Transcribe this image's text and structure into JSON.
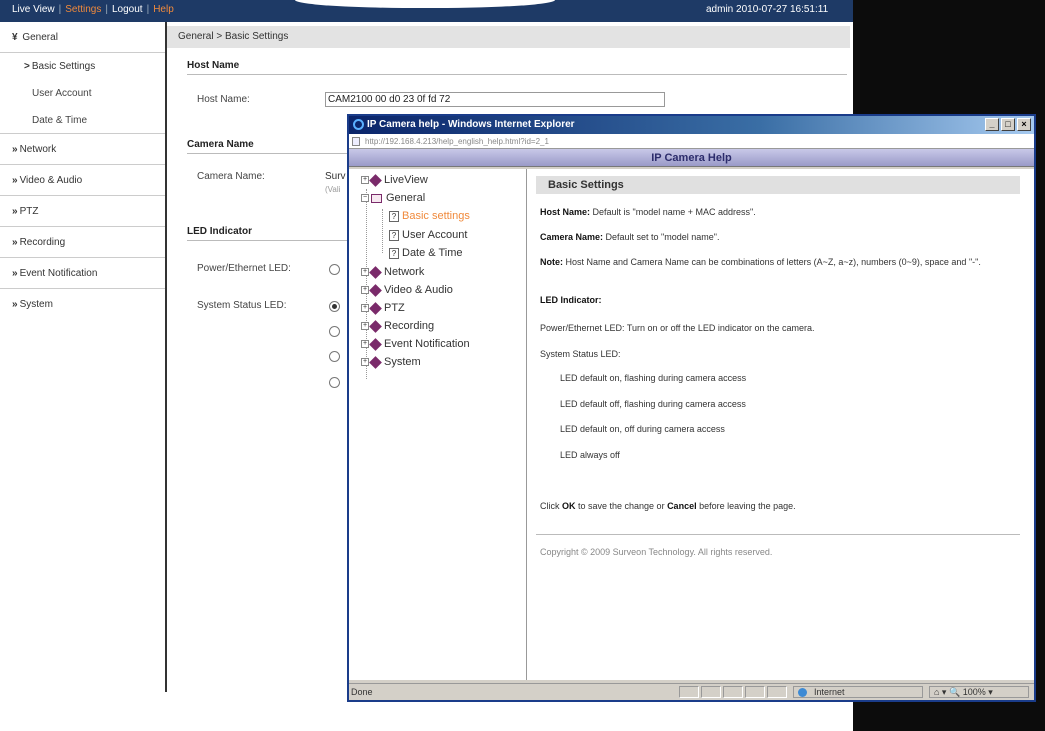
{
  "topbar": {
    "nav": [
      "Live View",
      "Settings",
      "Logout",
      "Help"
    ],
    "user": "admin",
    "datetime": "2010-07-27  16:51:11"
  },
  "sidebar": {
    "general": "General",
    "sub": [
      "Basic Settings",
      "User Account",
      "Date & Time"
    ],
    "items": [
      "Network",
      "Video & Audio",
      "PTZ",
      "Recording",
      "Event Notification",
      "System"
    ]
  },
  "main": {
    "breadcrumb": "General > Basic Settings",
    "host_section": "Host Name",
    "host_label": "Host Name:",
    "host_value": "CAM2100 00 d0 23 0f fd 72",
    "camera_section": "Camera Name",
    "camera_label": "Camera Name:",
    "camera_value": "Surv",
    "camera_hint": "(Vali",
    "led_section": "LED Indicator",
    "power_led_label": "Power/Ethernet LED:",
    "status_led_label": "System Status LED:"
  },
  "ie": {
    "title": "IP Camera help - Windows Internet Explorer",
    "address": "http://192.168.4.213/help_english_help.html?id=2_1",
    "banner": "IP Camera Help",
    "tree": {
      "liveview": "LiveView",
      "general": "General",
      "basic": "Basic settings",
      "user": "User Account",
      "date": "Date & Time",
      "network": "Network",
      "video": "Video & Audio",
      "ptz": "PTZ",
      "recording": "Recording",
      "event": "Event Notification",
      "system": "System"
    },
    "content": {
      "title": "Basic Settings",
      "host_bold": "Host Name:",
      "host_text": " Default is \"model name + MAC address\".",
      "camera_bold": "Camera Name:",
      "camera_text": " Default set to \"model name\".",
      "note_bold": "Note:",
      "note_text": " Host Name and Camera Name can be combinations of letters (A~Z, a~z), numbers (0~9), space and \"-\".",
      "led_title": "LED Indicator:",
      "power_led": "Power/Ethernet LED: Turn on or off the LED indicator on the camera.",
      "status_led": "System Status LED:",
      "opt1": "LED default on, flashing during camera access",
      "opt2": "LED default off, flashing during camera access",
      "opt3": "LED default on, off during camera access",
      "opt4": "LED always off",
      "click_pre": "Click ",
      "ok": "OK",
      "click_mid": " to save the change or ",
      "cancel": "Cancel",
      "click_post": " before leaving the page.",
      "copyright": "Copyright © 2009 Surveon Technology. All rights reserved."
    },
    "status": {
      "done": "Done",
      "zone": "Internet",
      "zoom": "100%"
    }
  }
}
